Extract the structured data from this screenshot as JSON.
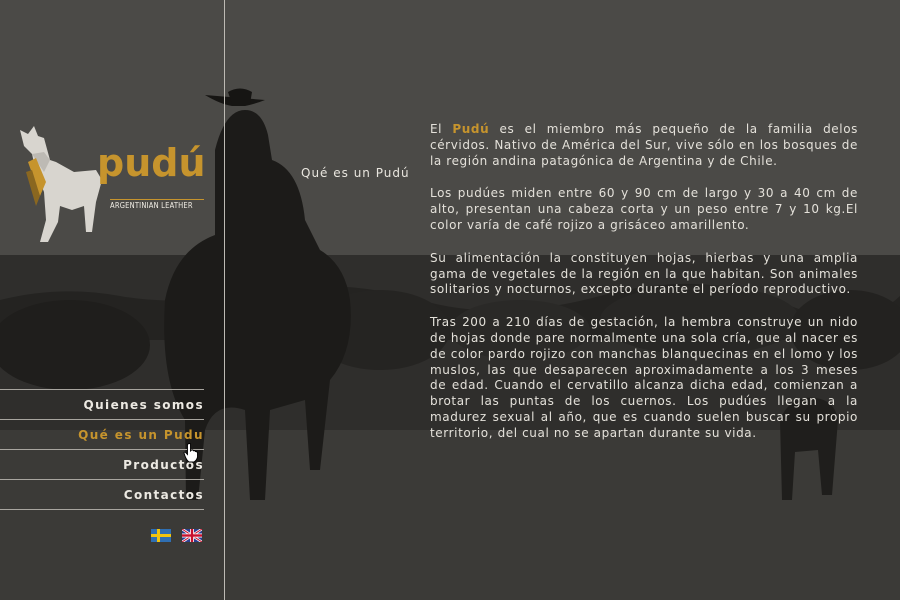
{
  "brand": {
    "name": "pudú",
    "tagline": "ARGENTINIAN LEATHER",
    "accent_color": "#c6942d"
  },
  "page": {
    "section_title": "Qué es un Pudú"
  },
  "content": {
    "p1_prefix": "El ",
    "p1_highlight": "Pudú",
    "p1_rest": " es el miembro más pequeño de la familia delos cérvidos. Nativo de América del Sur, vive sólo en los bosques de la región andina patagónica de Argentina y de Chile.",
    "p2": "Los pudúes miden entre 60 y 90 cm de largo y 30 a 40 cm de alto, presentan una cabeza corta y un peso entre 7 y 10 kg.El color varía de café rojizo a grisáceo amarillento.",
    "p3": "Su alimentación la constituyen hojas, hierbas y una amplia gama de vegetales de la región en la que habitan. Son animales solitarios y nocturnos, excepto durante el período reproductivo.",
    "p4": "Tras 200 a 210 días de gestación, la hembra construye un nido de hojas donde pare normalmente una sola cría, que al nacer es de color pardo rojizo con manchas blanquecinas en el lomo y los muslos, las que desaparecen aproximadamente a los 3 meses de edad. Cuando el cervatillo alcanza dicha edad, comienzan a brotar las puntas de los cuernos. Los pudúes llegan a la madurez sexual al año, que es cuando suelen buscar su propio territorio, del cual no se apartan durante su vida."
  },
  "nav": {
    "items": [
      {
        "label": "Quienes somos"
      },
      {
        "label": "Qué es un Pudu"
      },
      {
        "label": "Productos"
      },
      {
        "label": "Contactos"
      }
    ],
    "active_index": 1
  },
  "languages": [
    {
      "icon": "sweden-flag-icon"
    },
    {
      "icon": "uk-flag-icon"
    }
  ]
}
